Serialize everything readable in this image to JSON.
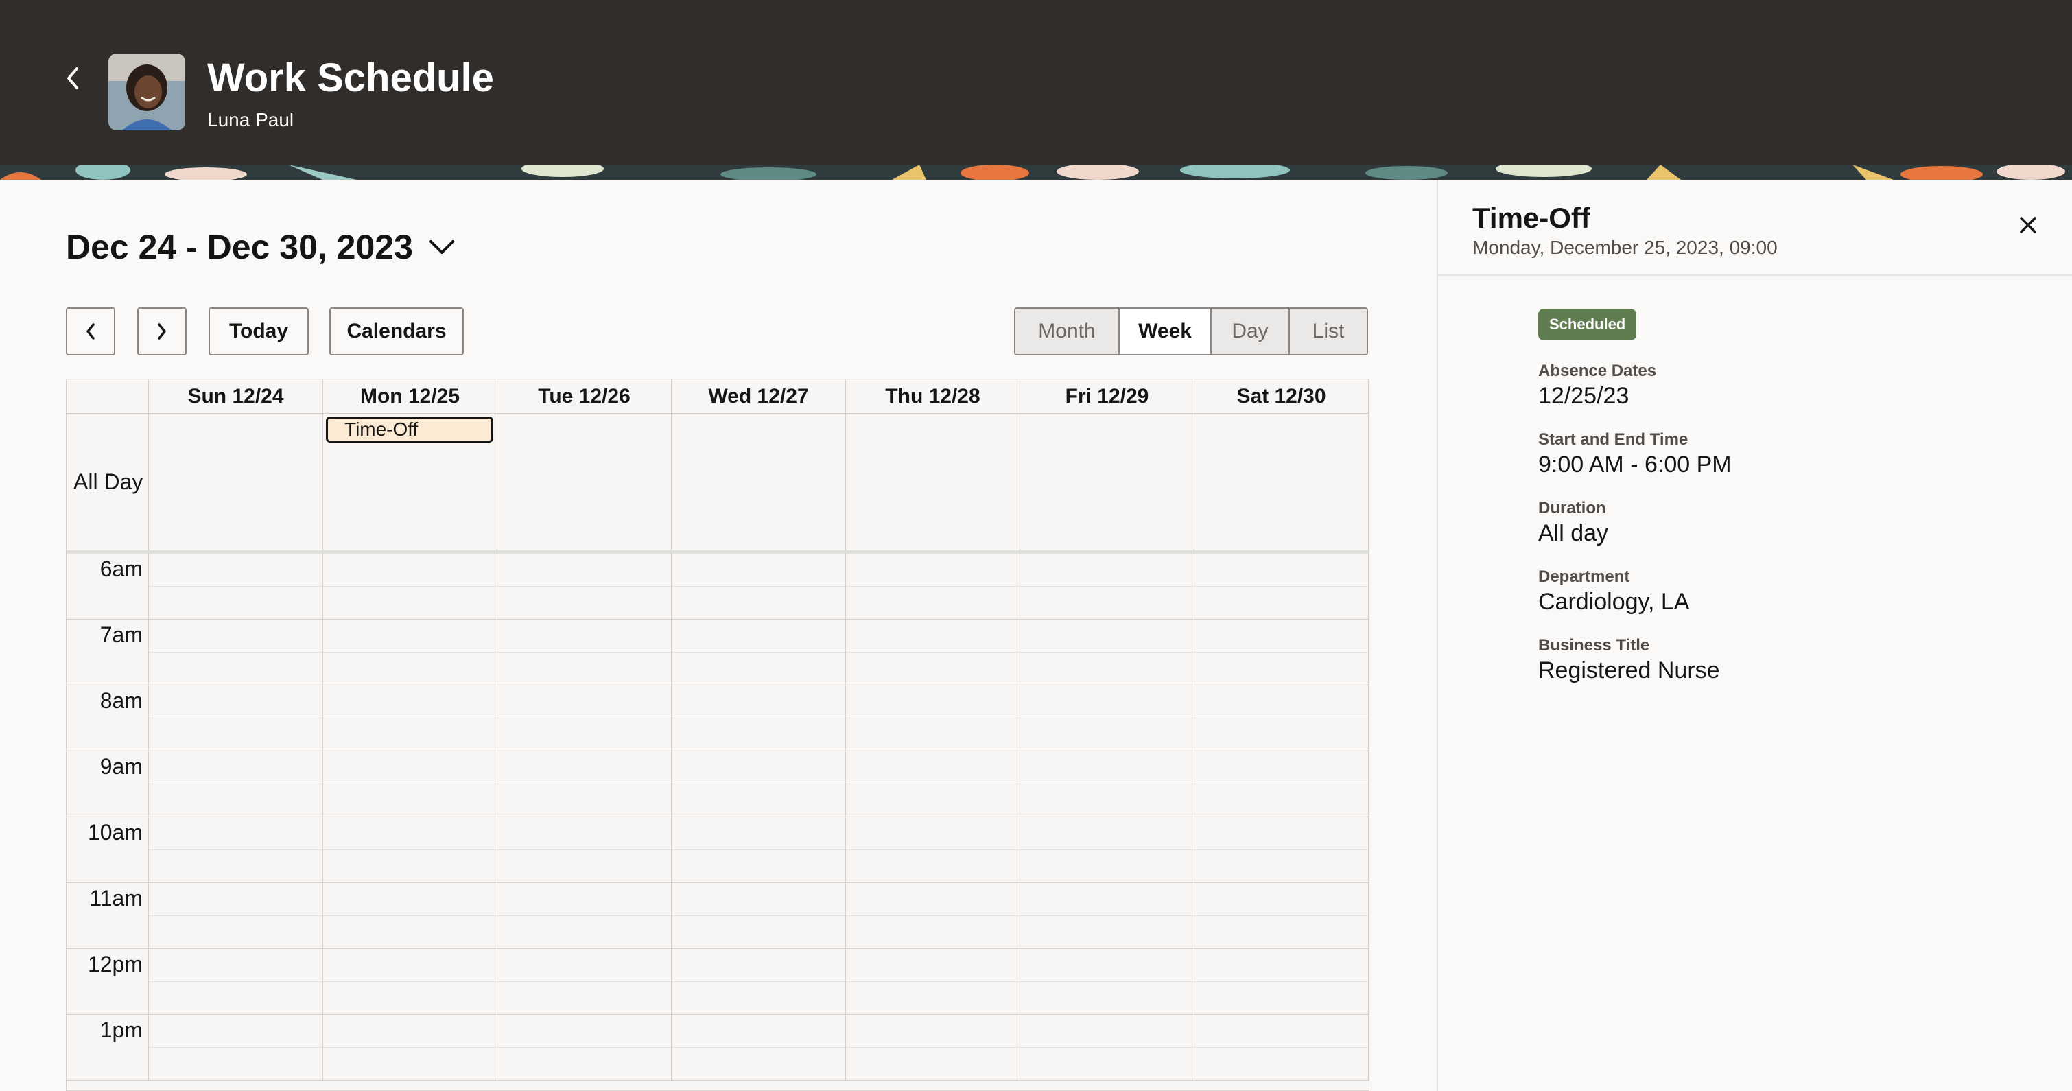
{
  "header": {
    "title": "Work Schedule",
    "subtitle": "Luna Paul"
  },
  "range": {
    "label": "Dec 24 - Dec 30, 2023"
  },
  "toolbar": {
    "today_label": "Today",
    "calendars_label": "Calendars",
    "views": [
      "Month",
      "Week",
      "Day",
      "List"
    ],
    "active_view": "Week"
  },
  "calendar": {
    "days": [
      "Sun 12/24",
      "Mon 12/25",
      "Tue 12/26",
      "Wed 12/27",
      "Thu 12/28",
      "Fri 12/29",
      "Sat 12/30"
    ],
    "all_day_label": "All Day",
    "event_label": "Time-Off",
    "hours": [
      "6am",
      "7am",
      "8am",
      "9am",
      "10am",
      "11am",
      "12pm",
      "1pm"
    ]
  },
  "panel": {
    "title": "Time-Off",
    "subtitle": "Monday, December 25, 2023, 09:00",
    "status": "Scheduled",
    "fields": [
      {
        "label": "Absence Dates",
        "value": "12/25/23"
      },
      {
        "label": "Start and End Time",
        "value": "9:00 AM - 6:00 PM"
      },
      {
        "label": "Duration",
        "value": "All day"
      },
      {
        "label": "Department",
        "value": "Cardiology, LA"
      },
      {
        "label": "Business Title",
        "value": "Registered Nurse"
      }
    ]
  },
  "colors": {
    "header_bg": "#312d2a",
    "badge_bg": "#5f7d4f",
    "event_bg": "#fcebd4"
  },
  "icons": {
    "back": "chevron-left-icon",
    "range_toggle": "chevron-down-icon",
    "prev": "chevron-left-icon",
    "next": "chevron-right-icon",
    "close": "close-icon"
  }
}
